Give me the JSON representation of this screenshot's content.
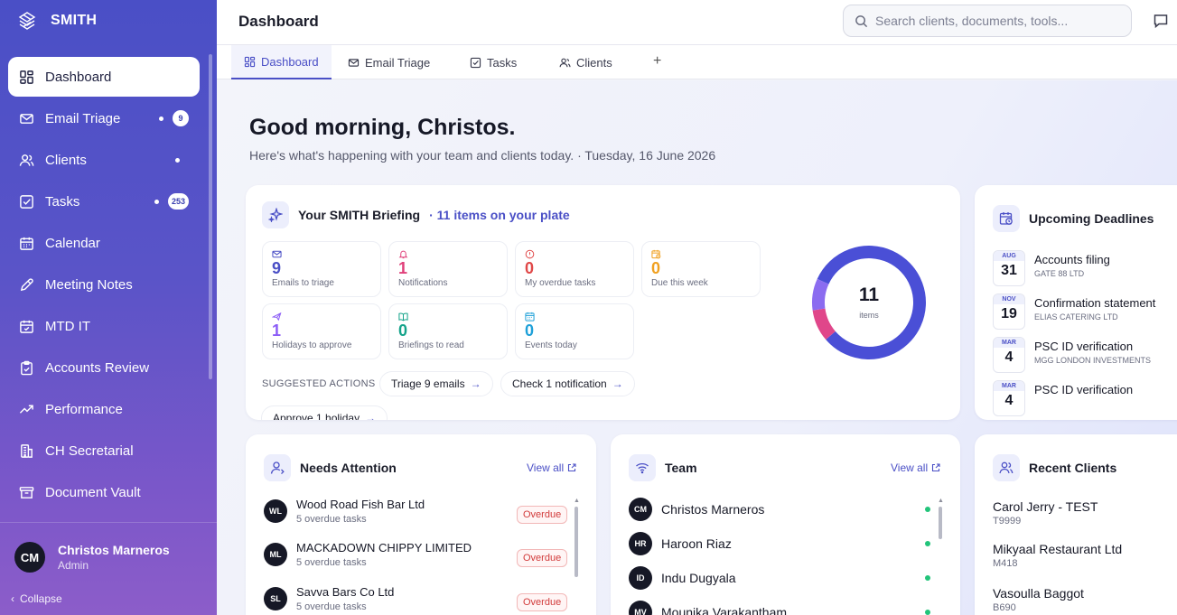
{
  "brand": {
    "name": "SMITH"
  },
  "sidebar": {
    "items": [
      {
        "label": "Dashboard",
        "icon": "grid-icon",
        "active": true
      },
      {
        "label": "Email Triage",
        "icon": "mail-icon",
        "dot": true,
        "badge": "9"
      },
      {
        "label": "Clients",
        "icon": "users-icon",
        "dot": true
      },
      {
        "label": "Tasks",
        "icon": "checkbox-icon",
        "dot": true,
        "badge": "253"
      },
      {
        "label": "Calendar",
        "icon": "calendar-icon"
      },
      {
        "label": "Meeting Notes",
        "icon": "pen-icon"
      },
      {
        "label": "MTD IT",
        "icon": "calendar-check-icon"
      },
      {
        "label": "Accounts Review",
        "icon": "clipboard-icon"
      },
      {
        "label": "Performance",
        "icon": "trend-icon"
      },
      {
        "label": "CH Secretarial",
        "icon": "building-icon"
      },
      {
        "label": "Document Vault",
        "icon": "archive-icon"
      }
    ],
    "user": {
      "initials": "CM",
      "name": "Christos Marneros",
      "role": "Admin"
    },
    "collapse_label": "Collapse"
  },
  "header": {
    "title": "Dashboard",
    "search_placeholder": "Search clients, documents, tools..."
  },
  "tabs": [
    {
      "label": "Dashboard",
      "icon": "grid-icon",
      "active": true
    },
    {
      "label": "Email Triage",
      "icon": "mail-icon"
    },
    {
      "label": "Tasks",
      "icon": "checkbox-icon"
    },
    {
      "label": "Clients",
      "icon": "users-icon"
    }
  ],
  "tab_add": "+",
  "greeting": {
    "title": "Good morning, Christos.",
    "subtitle": "Here's what's happening with your team and clients today. · Tuesday, 16 June 2026"
  },
  "briefing": {
    "title": "Your SMITH Briefing",
    "count_label": "· 11 items on your plate",
    "stats": [
      {
        "value": "9",
        "label": "Emails to triage",
        "color": "#4a4fc6",
        "icon": "mail-icon"
      },
      {
        "value": "1",
        "label": "Notifications",
        "color": "#e0407a",
        "icon": "bell-icon"
      },
      {
        "value": "0",
        "label": "My overdue tasks",
        "color": "#e04848",
        "icon": "alert-icon"
      },
      {
        "value": "0",
        "label": "Due this week",
        "color": "#f0a020",
        "icon": "calendar-clock-icon"
      },
      {
        "value": "1",
        "label": "Holidays to approve",
        "color": "#8b5cf6",
        "icon": "plane-icon"
      },
      {
        "value": "0",
        "label": "Briefings to read",
        "color": "#14a38a",
        "icon": "book-icon"
      },
      {
        "value": "0",
        "label": "Events today",
        "color": "#1ea0d8",
        "icon": "calendar-icon"
      }
    ],
    "suggested_label": "SUGGESTED ACTIONS",
    "actions": [
      "Triage 9 emails",
      "Check 1 notification",
      "Approve 1 holiday"
    ],
    "donut": {
      "total": "11",
      "total_label": "items",
      "segments": [
        {
          "value": 9,
          "color": "#4a4fd6"
        },
        {
          "value": 1,
          "color": "#e0468a"
        },
        {
          "value": 1,
          "color": "#8b6cf0"
        }
      ]
    }
  },
  "deadlines": {
    "title": "Upcoming Deadlines",
    "items": [
      {
        "month": "AUG",
        "day": "31",
        "title": "Accounts filing",
        "client": "GATE 88 LTD"
      },
      {
        "month": "NOV",
        "day": "19",
        "title": "Confirmation statement",
        "client": "ELIAS CATERING LTD"
      },
      {
        "month": "MAR",
        "day": "4",
        "title": "PSC ID verification",
        "client": "MGG LONDON INVESTMENTS"
      },
      {
        "month": "MAR",
        "day": "4",
        "title": "PSC ID verification",
        "client": ""
      }
    ]
  },
  "attention": {
    "title": "Needs Attention",
    "view_all": "View all",
    "items": [
      {
        "initials": "WL",
        "name": "Wood Road Fish Bar Ltd",
        "sub": "5 overdue tasks",
        "status": "Overdue"
      },
      {
        "initials": "ML",
        "name": "MACKADOWN CHIPPY LIMITED",
        "sub": "5 overdue tasks",
        "status": "Overdue"
      },
      {
        "initials": "SL",
        "name": "Savva Bars Co Ltd",
        "sub": "5 overdue tasks",
        "status": "Overdue"
      }
    ]
  },
  "team": {
    "title": "Team",
    "view_all": "View all",
    "members": [
      {
        "initials": "CM",
        "name": "Christos Marneros"
      },
      {
        "initials": "HR",
        "name": "Haroon Riaz"
      },
      {
        "initials": "ID",
        "name": "Indu Dugyala"
      },
      {
        "initials": "MV",
        "name": "Mounika Varakantham"
      }
    ]
  },
  "recent": {
    "title": "Recent Clients",
    "clients": [
      {
        "name": "Carol Jerry - TEST",
        "code": "T9999"
      },
      {
        "name": "Mikyaal Restaurant Ltd",
        "code": "M418"
      },
      {
        "name": "Vasoulla Baggot",
        "code": "B690"
      }
    ]
  }
}
